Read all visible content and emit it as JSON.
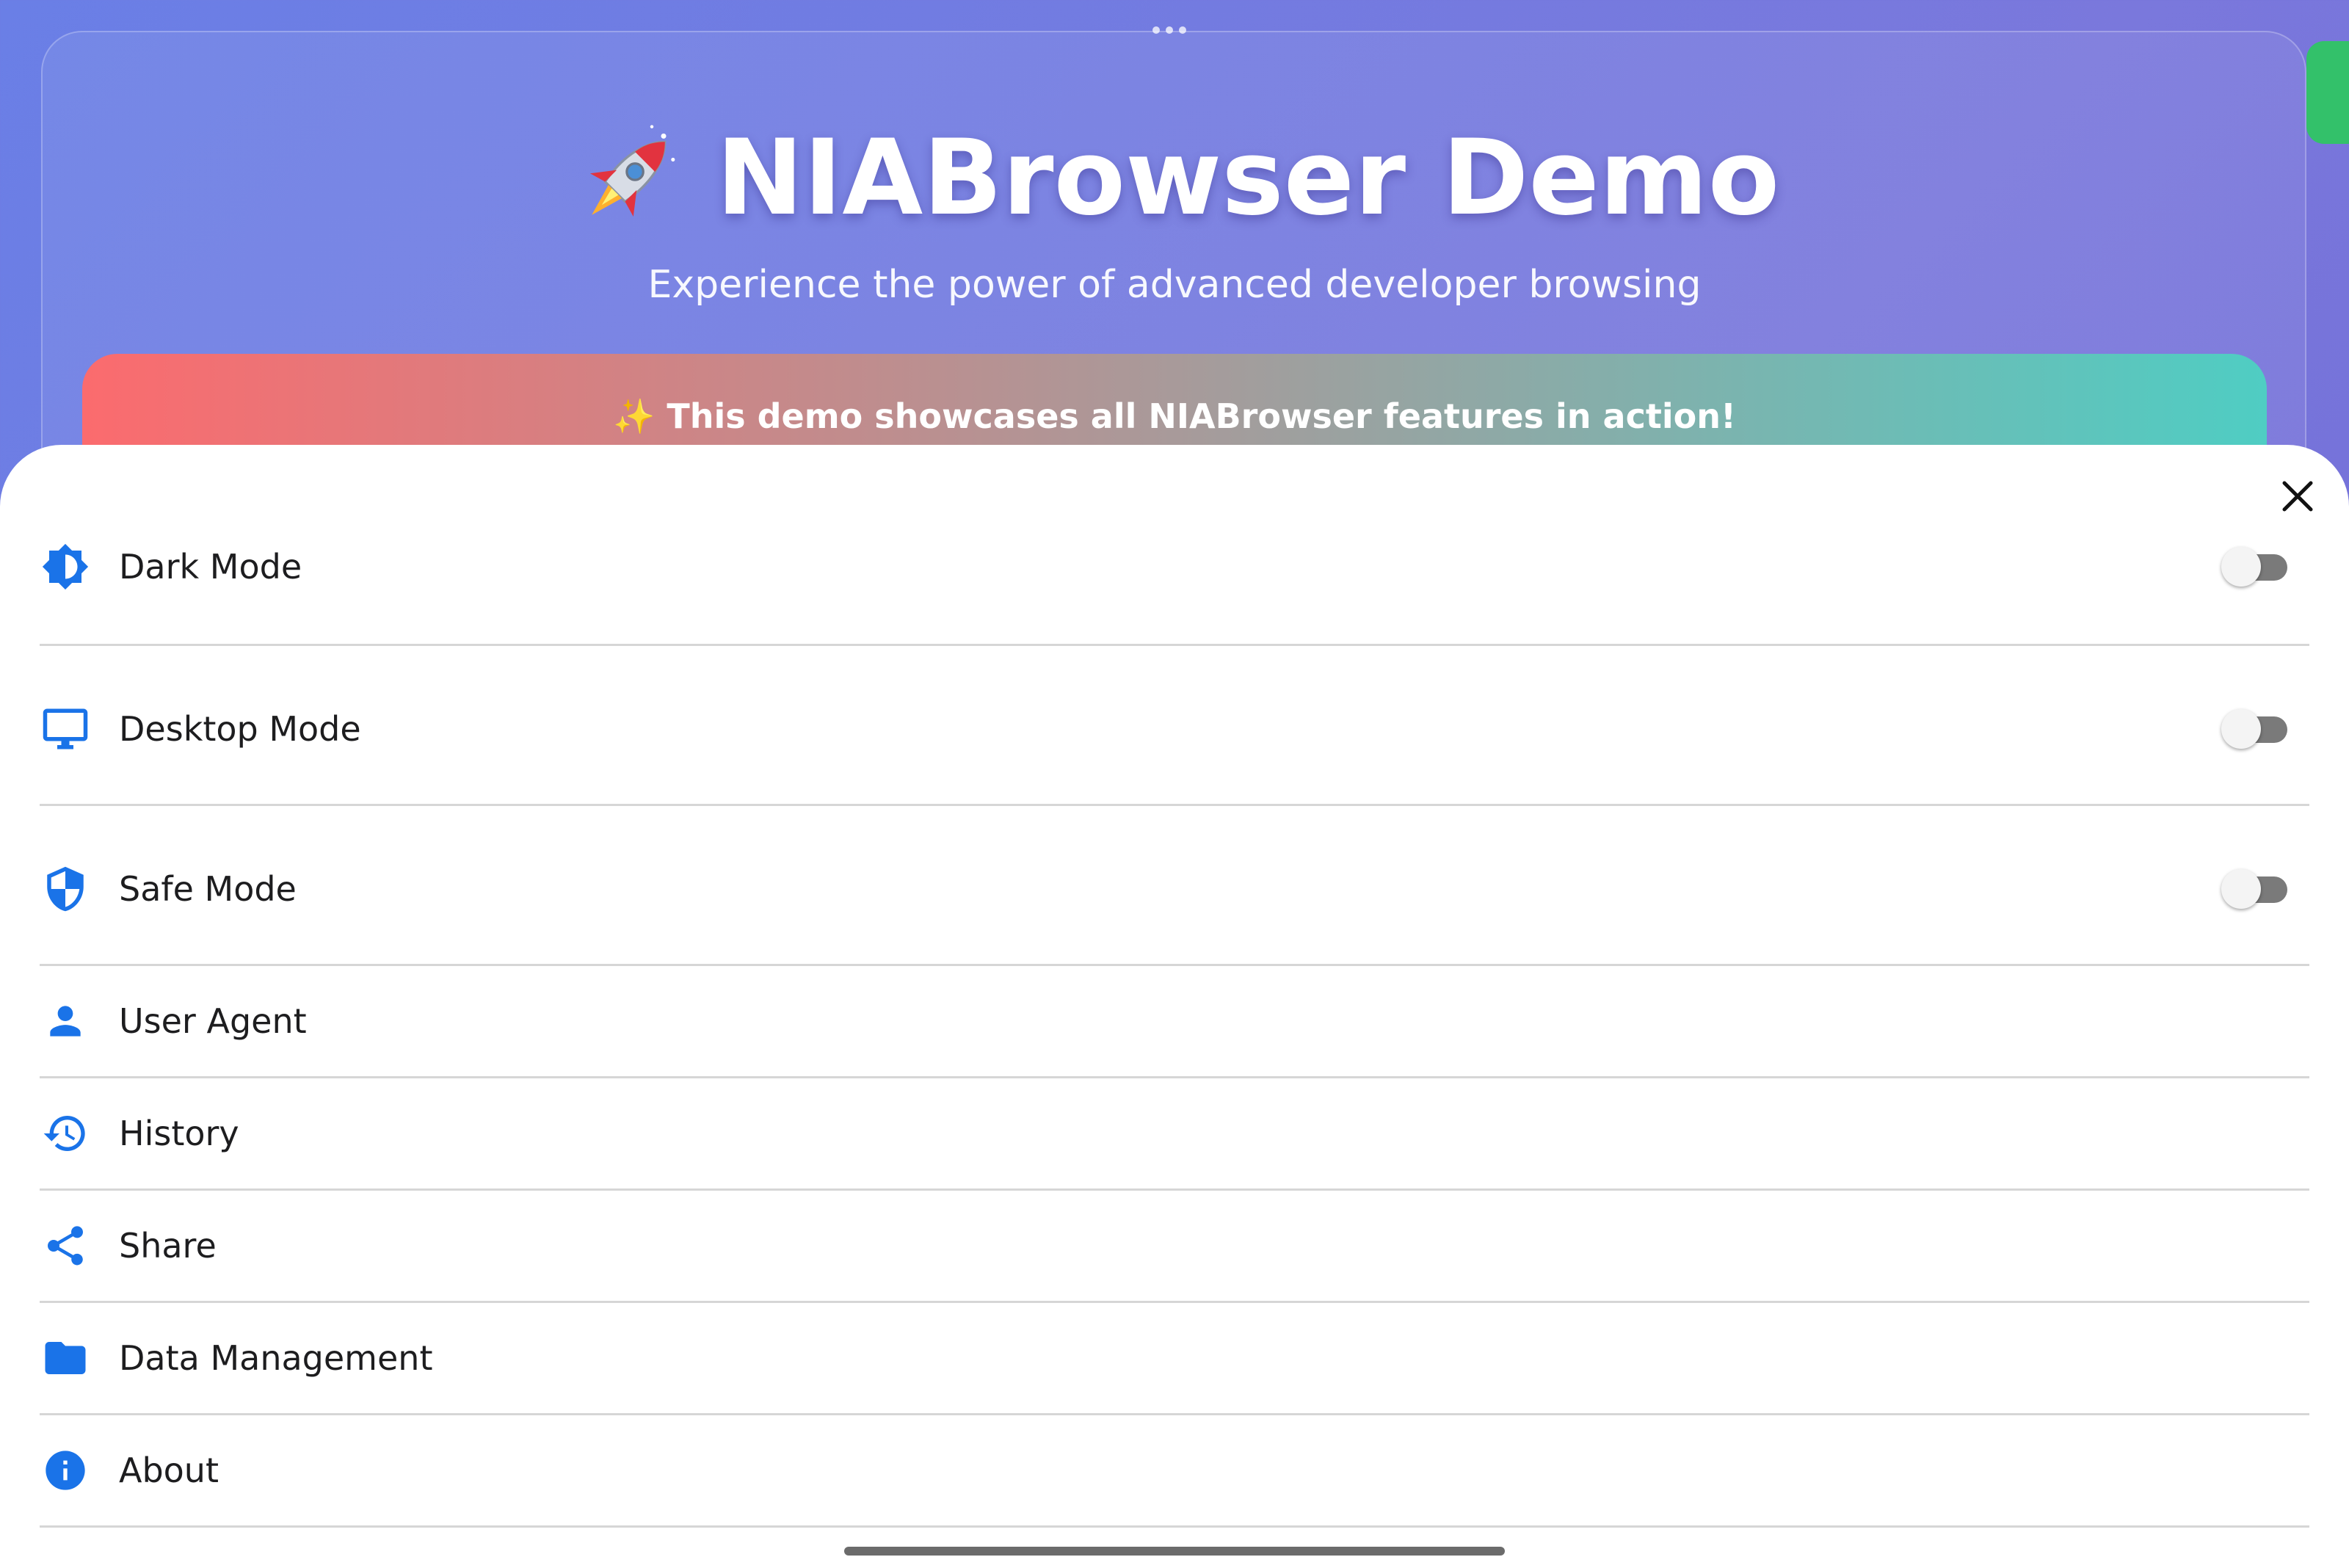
{
  "page": {
    "title": "NIABrowser Demo",
    "subtitle": "Experience the power of advanced developer browsing",
    "banner_text": "✨ This demo showcases all NIABrowser features in action!"
  },
  "menu": {
    "items": [
      {
        "label": "Dark Mode",
        "icon": "brightness-icon",
        "toggle": true,
        "enabled": false
      },
      {
        "label": "Desktop Mode",
        "icon": "monitor-icon",
        "toggle": true,
        "enabled": false
      },
      {
        "label": "Safe Mode",
        "icon": "shield-icon",
        "toggle": true,
        "enabled": false
      },
      {
        "label": "User Agent",
        "icon": "person-icon",
        "toggle": false
      },
      {
        "label": "History",
        "icon": "history-icon",
        "toggle": false
      },
      {
        "label": "Share",
        "icon": "share-icon",
        "toggle": false
      },
      {
        "label": "Data Management",
        "icon": "folder-icon",
        "toggle": false
      },
      {
        "label": "About",
        "icon": "info-icon",
        "toggle": false
      }
    ]
  },
  "colors": {
    "accent": "#1a73e8",
    "toggle_off_track": "#7a7a7a",
    "background_gradient_start": "#6a7fe6",
    "background_gradient_end": "#6f6ad6"
  }
}
